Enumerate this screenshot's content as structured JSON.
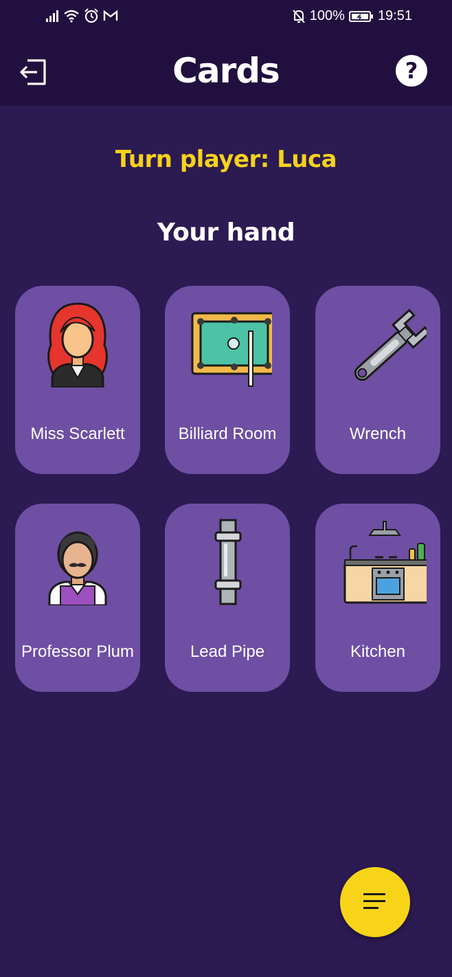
{
  "status_bar": {
    "battery": "100%",
    "time": "19:51"
  },
  "app_bar": {
    "title": "Cards"
  },
  "turn_player": "Turn player: Luca",
  "hand_title": "Your hand",
  "cards": [
    {
      "label": "Miss Scarlett",
      "icon": "miss-scarlett-icon"
    },
    {
      "label": "Billiard Room",
      "icon": "billiard-table-icon"
    },
    {
      "label": "Wrench",
      "icon": "wrench-icon"
    },
    {
      "label": "Professor Plum",
      "icon": "professor-plum-icon"
    },
    {
      "label": "Lead Pipe",
      "icon": "lead-pipe-icon"
    },
    {
      "label": "Kitchen",
      "icon": "kitchen-icon"
    }
  ],
  "colors": {
    "background": "#2c1a52",
    "app_bar": "#21103f",
    "card": "#6e4fa3",
    "accent_yellow": "#f6d21a"
  }
}
